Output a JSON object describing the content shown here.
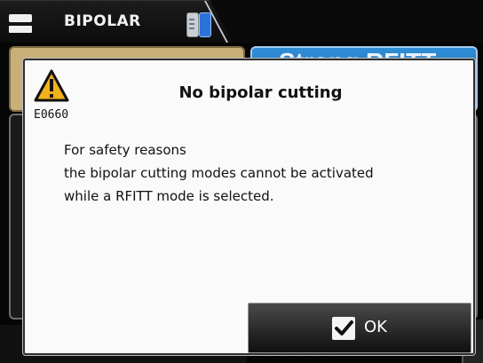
{
  "header": {
    "mode_label": "BIPOLAR",
    "menu_icon": "menu-icon",
    "device_icon": "bipolar-device-icon"
  },
  "background": {
    "right_mode_label": "Strong RFITT"
  },
  "dialog": {
    "error_code": "E0660",
    "title": "No bipolar cutting",
    "lines": [
      "For safety reasons",
      "the bipolar cutting modes cannot be activated",
      "while a RFITT mode is selected."
    ],
    "ok_label": "OK",
    "warning_icon": "warning-icon",
    "check_icon": "check-icon"
  },
  "colors": {
    "warning_yellow": "#f2b21c",
    "accent_blue": "#1f66b3",
    "gold_panel": "#c9b07a"
  }
}
